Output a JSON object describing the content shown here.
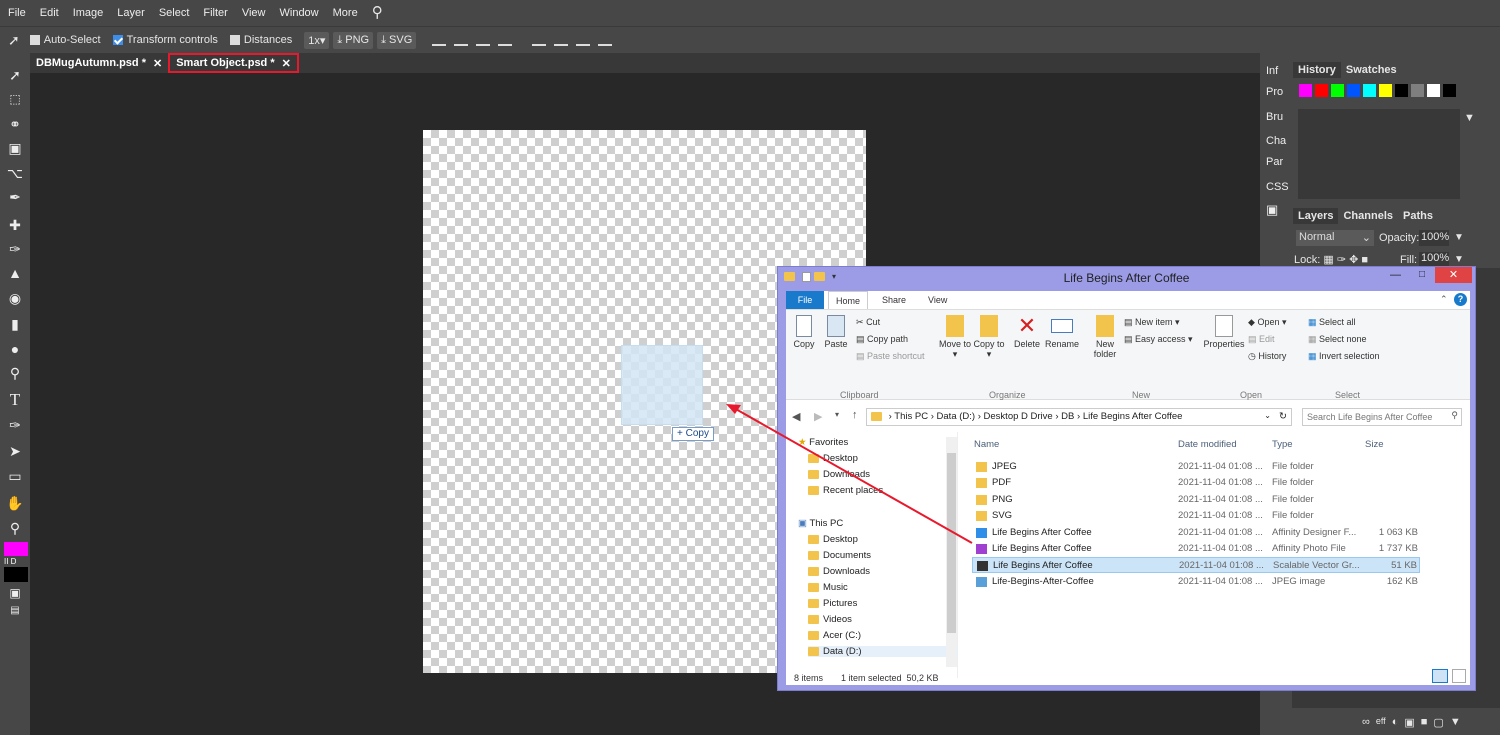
{
  "menu": [
    "File",
    "Edit",
    "Image",
    "Layer",
    "Select",
    "Filter",
    "View",
    "Window",
    "More"
  ],
  "options": {
    "auto_select": "Auto-Select",
    "transform_controls": "Transform controls",
    "distances": "Distances",
    "zoom": "1x",
    "png": "PNG",
    "svg": "SVG"
  },
  "tabs": [
    {
      "label": "DBMugAutumn.psd *",
      "close": "✕"
    },
    {
      "label": "Smart Object.psd *",
      "close": "✕"
    }
  ],
  "drag_badge": "+ Copy",
  "collapsed_panels": [
    "Inf",
    "Pro",
    "Bru",
    "Cha",
    "Par",
    "CSS"
  ],
  "history_panel": {
    "tab1": "History",
    "tab2": "Swatches"
  },
  "swatch_colors": [
    "#ff00ff",
    "#ff0000",
    "#00ff00",
    "#0055ff",
    "#00ffff",
    "#ffff00",
    "#000000",
    "#7f7f7f",
    "#ffffff",
    "#000000"
  ],
  "layers_panel": {
    "tab1": "Layers",
    "tab2": "Channels",
    "tab3": "Paths",
    "blend_mode": "Normal",
    "opacity_label": "Opacity:",
    "opacity": "100%",
    "lock_label": "Lock:",
    "fill_label": "Fill:",
    "fill": "100%"
  },
  "bottom_icons": [
    "link-icon",
    "fx-icon",
    "adjustment-icon",
    "mask-icon",
    "folder-icon",
    "new-layer-icon",
    "trash-icon"
  ],
  "explorer": {
    "title": "Life Begins After Coffee",
    "ribbon_tabs": [
      "File",
      "Home",
      "Share",
      "View"
    ],
    "clipboard": {
      "copy": "Copy",
      "paste": "Paste",
      "cut": "Cut",
      "copy_path": "Copy path",
      "paste_shortcut": "Paste shortcut",
      "group": "Clipboard"
    },
    "organize": {
      "move_to": "Move to ▾",
      "copy_to": "Copy to ▾",
      "delete": "Delete",
      "rename": "Rename",
      "group": "Organize"
    },
    "new": {
      "new_folder": "New folder",
      "new_item": "New item ▾",
      "easy_access": "Easy access ▾",
      "group": "New"
    },
    "open": {
      "properties": "Properties",
      "open": "Open ▾",
      "edit": "Edit",
      "history": "History",
      "group": "Open"
    },
    "select": {
      "select_all": "Select all",
      "select_none": "Select none",
      "invert": "Invert selection",
      "group": "Select"
    },
    "path": [
      "This PC",
      "Data (D:)",
      "Desktop D Drive",
      "DB",
      "Life Begins After Coffee"
    ],
    "search_placeholder": "Search Life Begins After Coffee",
    "nav": [
      {
        "label": "Favorites",
        "indent": 0
      },
      {
        "label": "Desktop",
        "indent": 1
      },
      {
        "label": "Downloads",
        "indent": 1
      },
      {
        "label": "Recent places",
        "indent": 1
      },
      {
        "label": "This PC",
        "indent": 0
      },
      {
        "label": "Desktop",
        "indent": 1
      },
      {
        "label": "Documents",
        "indent": 1
      },
      {
        "label": "Downloads",
        "indent": 1
      },
      {
        "label": "Music",
        "indent": 1
      },
      {
        "label": "Pictures",
        "indent": 1
      },
      {
        "label": "Videos",
        "indent": 1
      },
      {
        "label": "Acer (C:)",
        "indent": 1
      },
      {
        "label": "Data (D:)",
        "indent": 1
      }
    ],
    "columns": [
      "Name",
      "Date modified",
      "Type",
      "Size"
    ],
    "files": [
      {
        "name": "JPEG",
        "date": "2021-11-04 01:08 ...",
        "type": "File folder",
        "size": "",
        "icon": "folder"
      },
      {
        "name": "PDF",
        "date": "2021-11-04 01:08 ...",
        "type": "File folder",
        "size": "",
        "icon": "folder"
      },
      {
        "name": "PNG",
        "date": "2021-11-04 01:08 ...",
        "type": "File folder",
        "size": "",
        "icon": "folder"
      },
      {
        "name": "SVG",
        "date": "2021-11-04 01:08 ...",
        "type": "File folder",
        "size": "",
        "icon": "folder"
      },
      {
        "name": "Life Begins After Coffee",
        "date": "2021-11-04 01:08 ...",
        "type": "Affinity Designer F...",
        "size": "1 063 KB",
        "icon": "afdesign"
      },
      {
        "name": "Life Begins After Coffee",
        "date": "2021-11-04 01:08 ...",
        "type": "Affinity Photo File",
        "size": "1 737 KB",
        "icon": "afphoto"
      },
      {
        "name": "Life Begins After Coffee",
        "date": "2021-11-04 01:08 ...",
        "type": "Scalable Vector Gr...",
        "size": "51 KB",
        "icon": "svg"
      },
      {
        "name": "Life-Begins-After-Coffee",
        "date": "2021-11-04 01:08 ...",
        "type": "JPEG image",
        "size": "162 KB",
        "icon": "jpeg"
      }
    ],
    "status_items": "8 items",
    "status_selected": "1 item selected  50,2 KB"
  }
}
